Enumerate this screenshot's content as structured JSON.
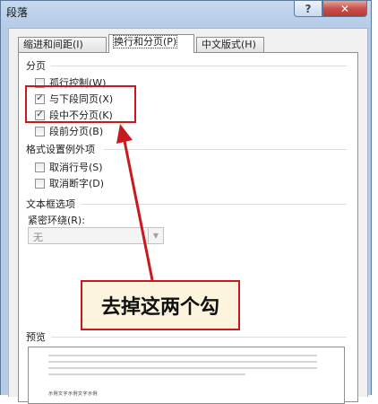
{
  "window": {
    "title": "段落",
    "help_label": "?",
    "close_label": "✕"
  },
  "tabs": [
    {
      "label": "缩进和间距(I)",
      "active": false
    },
    {
      "label": "换行和分页(P)",
      "active": true
    },
    {
      "label": "中文版式(H)",
      "active": false
    }
  ],
  "pagination": {
    "section_label": "分页",
    "options": [
      {
        "label": "孤行控制(W)",
        "checked": false
      },
      {
        "label": "与下段同页(X)",
        "checked": true
      },
      {
        "label": "段中不分页(K)",
        "checked": true
      },
      {
        "label": "段前分页(B)",
        "checked": false
      }
    ]
  },
  "formatting_exceptions": {
    "section_label": "格式设置例外项",
    "options": [
      {
        "label": "取消行号(S)",
        "checked": false
      },
      {
        "label": "取消断字(D)",
        "checked": false
      }
    ]
  },
  "textbox_options": {
    "section_label": "文本框选项",
    "wrap_label": "紧密环绕(R):",
    "wrap_value": "无"
  },
  "preview": {
    "section_label": "预览",
    "sample_text": "示例文字示例文字示例"
  },
  "annotation": {
    "callout_text": "去掉这两个勾",
    "color": "#c8191e"
  }
}
